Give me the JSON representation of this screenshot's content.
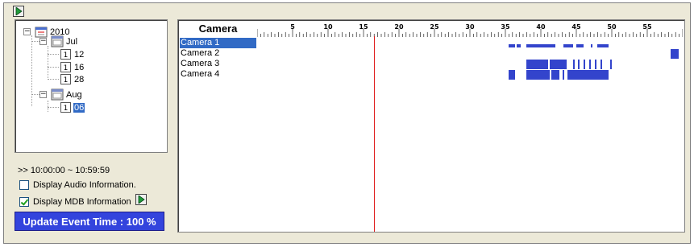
{
  "tree": {
    "nodes": [
      {
        "label": "2010",
        "type": "year",
        "icon": "calendar-year-icon"
      },
      {
        "label": "Jul",
        "type": "month",
        "icon": "calendar-month-icon"
      },
      {
        "label": "12",
        "type": "day",
        "icon": "calendar-day-icon"
      },
      {
        "label": "16",
        "type": "day",
        "icon": "calendar-day-icon"
      },
      {
        "label": "28",
        "type": "day",
        "icon": "calendar-day-icon"
      },
      {
        "label": "Aug",
        "type": "month",
        "icon": "calendar-month-icon"
      },
      {
        "label": "06",
        "type": "day",
        "icon": "calendar-day-icon",
        "selected": true
      }
    ],
    "expander_minus": "−"
  },
  "time_range": ">> 10:00:00 ~ 10:59:59",
  "options": {
    "audio": {
      "label": "Display Audio Information.",
      "checked": false
    },
    "mdb": {
      "label": "Display MDB Information",
      "checked": true
    }
  },
  "update_label": "Update Event Time : 100 %",
  "timeline": {
    "header": "Camera",
    "ruler_labels": [
      "5",
      "10",
      "15",
      "20",
      "25",
      "30",
      "35",
      "40",
      "45",
      "50",
      "55"
    ],
    "ruler_range": [
      0,
      60
    ],
    "cursor_minute": 16.5,
    "cameras": [
      {
        "name": "Camera 1",
        "selected": true,
        "events": [
          [
            35.5,
            36.4
          ],
          [
            36.6,
            37.2
          ],
          [
            38.0,
            42.0
          ],
          [
            43.2,
            44.6
          ],
          [
            45.0,
            46.0
          ],
          [
            47.0,
            47.3
          ],
          [
            48.0,
            49.5
          ]
        ]
      },
      {
        "name": "Camera 2",
        "selected": false,
        "events": [
          [
            58.3,
            59.4
          ]
        ]
      },
      {
        "name": "Camera 3",
        "selected": false,
        "events": [
          [
            38.0,
            39.0
          ],
          [
            39.0,
            40.2
          ],
          [
            40.2,
            41.0
          ],
          [
            41.3,
            42.5
          ],
          [
            42.5,
            43.6
          ],
          [
            44.5,
            44.7
          ],
          [
            45.2,
            45.4
          ],
          [
            46.0,
            46.2
          ],
          [
            46.8,
            47.0
          ],
          [
            47.6,
            47.8
          ],
          [
            48.4,
            48.6
          ],
          [
            49.8,
            50.0
          ]
        ]
      },
      {
        "name": "Camera 4",
        "selected": false,
        "events": [
          [
            35.5,
            36.4
          ],
          [
            37.9,
            41.2
          ],
          [
            41.5,
            42.6
          ],
          [
            43.1,
            43.3
          ],
          [
            43.8,
            49.6
          ]
        ]
      }
    ]
  },
  "colors": {
    "selection": "#316ac5",
    "event_bar": "#3344cc",
    "cursor": "#e02020",
    "update_bg": "#3344dd"
  }
}
